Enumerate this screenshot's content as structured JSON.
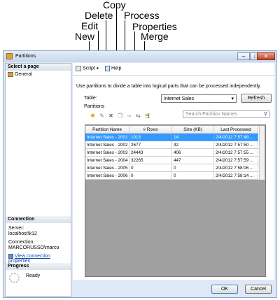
{
  "callouts": {
    "new": "New",
    "edit": "Edit",
    "delete": "Delete",
    "copy": "Copy",
    "process": "Process",
    "properties": "Properties",
    "merge": "Merge"
  },
  "window": {
    "title": "Partitions",
    "buttons": {
      "minimize": "–",
      "maximize": "□",
      "close": "✕"
    }
  },
  "left_pane": {
    "select_page_header": "Select a page",
    "pages": [
      {
        "label": "General"
      }
    ],
    "connection_header": "Connection",
    "server_label": "Server:",
    "server_value": "localhost\\k12",
    "connection_label": "Connection:",
    "connection_value": "MARCORUSSO\\marco",
    "view_connection_link": "View connection properties",
    "progress_header": "Progress",
    "progress_status": "Ready"
  },
  "toolbar": {
    "script_label": "Script",
    "help_label": "Help"
  },
  "main": {
    "description": "Use partitions to divide a table into logical parts that can be processed independently.",
    "table_label": "Table:",
    "table_selected": "Internet Sales",
    "refresh_label": "Refresh",
    "partitions_label": "Partitions",
    "search_placeholder": "Search Partition Names"
  },
  "grid": {
    "columns": [
      "Partition Name",
      "# Rows",
      "Size (KB)",
      "Last Processed"
    ],
    "rows": [
      [
        "Internet Sales - 2001",
        "1013",
        "14",
        "2/4/2012 7:57:48 ..."
      ],
      [
        "Internet Sales - 2002",
        "2677",
        "42",
        "2/4/2012 7:57:50 ..."
      ],
      [
        "Internet Sales - 2003",
        "24443",
        "406",
        "2/4/2012 7:57:55 ..."
      ],
      [
        "Internet Sales - 2004",
        "32265",
        "447",
        "2/4/2012 7:57:59 ..."
      ],
      [
        "Internet Sales - 2005",
        "0",
        "0",
        "2/4/2012 7:58:06 ..."
      ],
      [
        "Internet Sales - 2006",
        "0",
        "0",
        "2/4/2012 7:58:14 ..."
      ]
    ],
    "selected_row": 0
  },
  "footer": {
    "ok_label": "OK",
    "cancel_label": "Cancel"
  }
}
